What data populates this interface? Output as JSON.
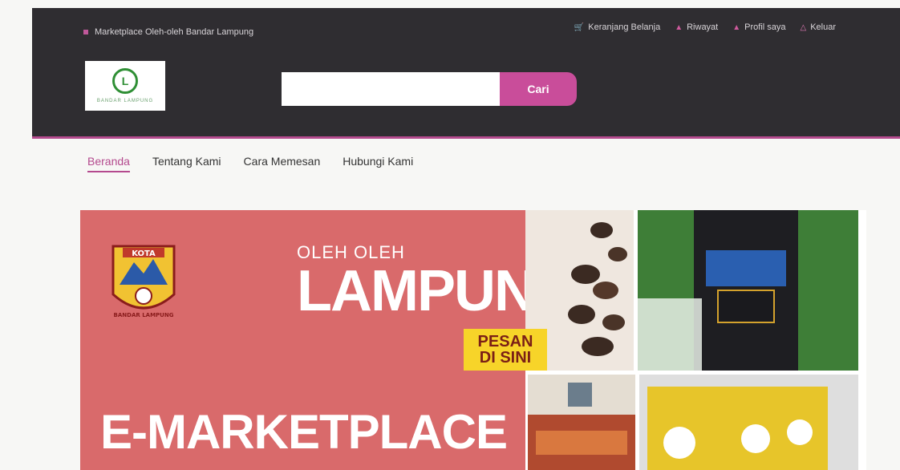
{
  "topbar": {
    "site_label": "Marketplace Oleh-oleh Bandar Lampung",
    "links": [
      {
        "label": "Keranjang Belanja",
        "icon": "cart-icon"
      },
      {
        "label": "Riwayat",
        "icon": "history-icon"
      },
      {
        "label": "Profil saya",
        "icon": "user-icon"
      },
      {
        "label": "Keluar",
        "icon": "logout-icon"
      }
    ]
  },
  "search": {
    "placeholder": "",
    "button_label": "Cari"
  },
  "nav": {
    "items": [
      "Beranda",
      "Tentang Kami",
      "Cara Memesan",
      "Hubungi Kami"
    ],
    "active": "Beranda"
  },
  "banner": {
    "emblem_text": "KOTA",
    "emblem_bottom": "BANDAR LAMPUNG",
    "subtitle": "OLEH OLEH",
    "title": "LAMPUN",
    "cta_line1": "PESAN",
    "cta_line2": "DI SINI",
    "headline": "E-MARKETPLACE"
  },
  "colors": {
    "topbar_bg": "#2f2d31",
    "accent": "#c94d9a",
    "banner_red": "#d96a6b",
    "cta_yellow": "#f7d429"
  }
}
